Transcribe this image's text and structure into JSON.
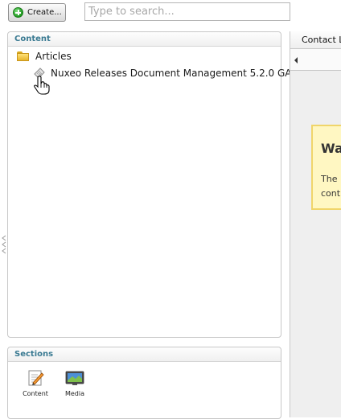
{
  "toolbar": {
    "create_label": "Create...",
    "search_placeholder": "Type to search..."
  },
  "content_panel": {
    "title": "Content",
    "tree": [
      {
        "label": "Articles",
        "icon": "folder-icon"
      },
      {
        "label": "Nuxeo Releases Document Management 5.2.0 GA",
        "icon": "document-icon"
      }
    ]
  },
  "sections_panel": {
    "title": "Sections",
    "items": [
      {
        "label": "Content",
        "icon": "edit-document-icon"
      },
      {
        "label": "Media",
        "icon": "media-monitor-icon"
      }
    ]
  },
  "right_panel": {
    "tab_label": "Contact L",
    "warning_title": "Wa",
    "warning_lines": [
      "The",
      "cont"
    ]
  },
  "colors": {
    "panel_title": "#3a7a92",
    "warning_background": "#fff7c2",
    "warning_border": "#f0d56a",
    "create_icon": "#2aa52a"
  }
}
